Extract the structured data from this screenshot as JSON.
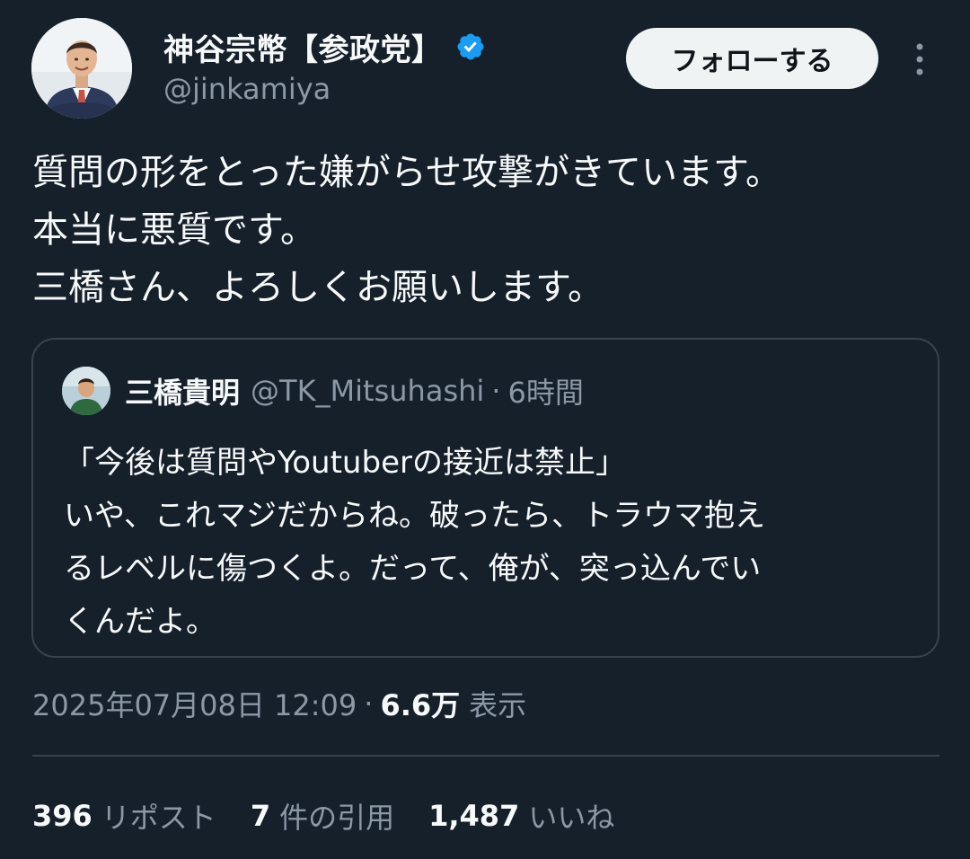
{
  "author": {
    "display_name": "神谷宗幣【参政党】",
    "handle": "@jinkamiya",
    "verified": true,
    "avatar_icon": "profile-photo"
  },
  "header": {
    "follow_label": "フォローする",
    "more_icon": "more-vertical-icon"
  },
  "tweet": {
    "lines": [
      "質問の形をとった嫌がらせ攻撃がきています。",
      "本当に悪質です。",
      "三橋さん、よろしくお願いします。"
    ]
  },
  "quote": {
    "display_name": "三橋貴明",
    "handle": "@TK_Mitsuhashi",
    "separator": "·",
    "time": "6時間",
    "lines": [
      "「今後は質問やYoutuberの接近は禁止」",
      "いや、これマジだからね。破ったら、トラウマ抱え",
      "るレベルに傷つくよ。だって、俺が、突っ込んでい",
      "くんだよ。"
    ]
  },
  "meta": {
    "timestamp": "2025年07月08日 12:09",
    "separator": "·",
    "views_count": "6.6万",
    "views_label": "表示"
  },
  "stats": {
    "reposts_count": "396",
    "reposts_label": "リポスト",
    "quotes_count": "7",
    "quotes_label": "件の引用",
    "likes_count": "1,487",
    "likes_label": "いいね"
  },
  "colors": {
    "background": "#15202b",
    "text": "#f7f9f9",
    "secondary": "#8b98a5",
    "border": "#38444d",
    "verified": "#1d9bf0"
  }
}
